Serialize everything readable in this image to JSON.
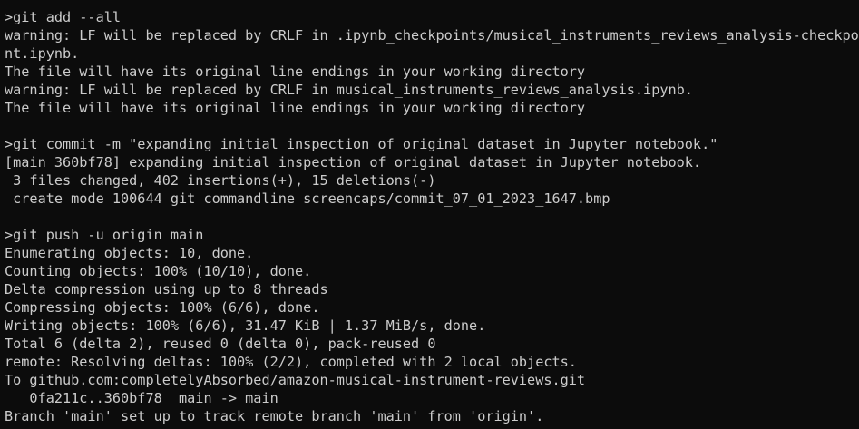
{
  "colors": {
    "background": "#0c0c0c",
    "foreground": "#cccccc"
  },
  "terminal": {
    "lines": [
      ">git add --all",
      "warning: LF will be replaced by CRLF in .ipynb_checkpoints/musical_instruments_reviews_analysis-checkpoi",
      "nt.ipynb.",
      "The file will have its original line endings in your working directory",
      "warning: LF will be replaced by CRLF in musical_instruments_reviews_analysis.ipynb.",
      "The file will have its original line endings in your working directory",
      "",
      ">git commit -m \"expanding initial inspection of original dataset in Jupyter notebook.\"",
      "[main 360bf78] expanding initial inspection of original dataset in Jupyter notebook.",
      " 3 files changed, 402 insertions(+), 15 deletions(-)",
      " create mode 100644 git commandline screencaps/commit_07_01_2023_1647.bmp",
      "",
      ">git push -u origin main",
      "Enumerating objects: 10, done.",
      "Counting objects: 100% (10/10), done.",
      "Delta compression using up to 8 threads",
      "Compressing objects: 100% (6/6), done.",
      "Writing objects: 100% (6/6), 31.47 KiB | 1.37 MiB/s, done.",
      "Total 6 (delta 2), reused 0 (delta 0), pack-reused 0",
      "remote: Resolving deltas: 100% (2/2), completed with 2 local objects.",
      "To github.com:completelyAbsorbed/amazon-musical-instrument-reviews.git",
      "   0fa211c..360bf78  main -> main",
      "Branch 'main' set up to track remote branch 'main' from 'origin'."
    ]
  }
}
